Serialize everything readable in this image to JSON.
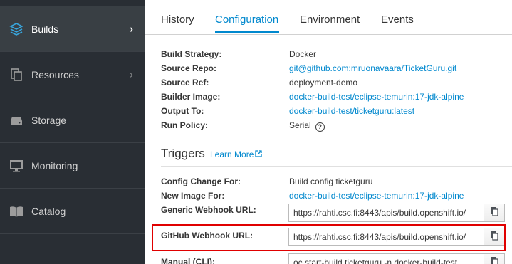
{
  "sidebar": {
    "items": [
      {
        "label": "Builds",
        "icon": "layers-icon",
        "active": true,
        "chevron": "›"
      },
      {
        "label": "Resources",
        "icon": "copy-docs-icon",
        "active": false,
        "chevron": "›"
      },
      {
        "label": "Storage",
        "icon": "hdd-icon",
        "active": false
      },
      {
        "label": "Monitoring",
        "icon": "desktop-icon",
        "active": false
      },
      {
        "label": "Catalog",
        "icon": "book-icon",
        "active": false
      }
    ]
  },
  "tabs": [
    {
      "label": "History"
    },
    {
      "label": "Configuration",
      "active": true
    },
    {
      "label": "Environment"
    },
    {
      "label": "Events"
    }
  ],
  "config": {
    "build_strategy": {
      "label": "Build Strategy:",
      "value": "Docker"
    },
    "source_repo": {
      "label": "Source Repo:",
      "value": "git@github.com:mruonavaara/TicketGuru.git"
    },
    "source_ref": {
      "label": "Source Ref:",
      "value": "deployment-demo"
    },
    "builder_image": {
      "label": "Builder Image:",
      "value": "docker-build-test/eclipse-temurin:17-jdk-alpine"
    },
    "output_to": {
      "label": "Output To:",
      "value": "docker-build-test/ticketguru:latest"
    },
    "run_policy": {
      "label": "Run Policy:",
      "value": "Serial",
      "help_glyph": "?"
    }
  },
  "triggers": {
    "title": "Triggers",
    "learn_more": "Learn More",
    "config_change": {
      "label": "Config Change For:",
      "value": "Build config ticketguru"
    },
    "new_image": {
      "label": "New Image For:",
      "value": "docker-build-test/eclipse-temurin:17-jdk-alpine"
    },
    "generic_webhook": {
      "label": "Generic Webhook URL:",
      "value": "https://rahti.csc.fi:8443/apis/build.openshift.io/"
    },
    "github_webhook": {
      "label": "GitHub Webhook URL:",
      "value": "https://rahti.csc.fi:8443/apis/build.openshift.io/"
    },
    "manual_cli": {
      "label": "Manual (CLI):",
      "value": "oc start-build ticketguru -n docker-build-test"
    }
  },
  "colors": {
    "sidebar_bg": "#292e34",
    "sidebar_active_bg": "#393f44",
    "accent": "#0088ce",
    "highlight": "#e00000"
  }
}
